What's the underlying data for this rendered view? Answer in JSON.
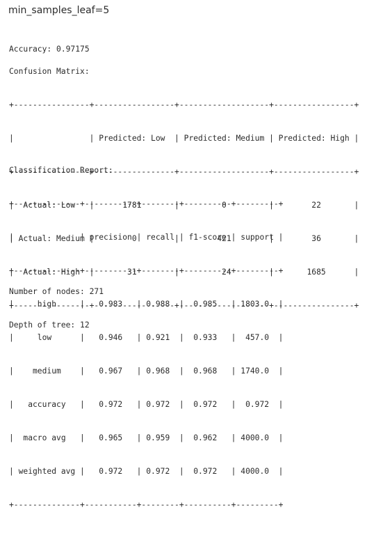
{
  "heading": "min_samples_leaf=5",
  "accuracy_text": "Accuracy: 0.97175",
  "confusion": {
    "title": "Confusion Matrix:",
    "rows": [
      "+----------------+-----------------+-------------------+-----------------+",
      "|                | Predicted: Low  | Predicted: Medium | Predicted: High |",
      "+----------------+-----------------+-------------------+-----------------+",
      "|  Actual: Low   |      1781       |         0         |        22       |",
      "| Actual: Medium |        0        |        421        |        36       |",
      "|  Actual: High  |       31        |         24        |       1685      |",
      "+----------------+-----------------+-------------------+-----------------+"
    ]
  },
  "report": {
    "title": "Classification Report:",
    "rows": [
      "+--------------+-----------+--------+----------+---------+",
      "|              | precision | recall | f1-score | support |",
      "+--------------+-----------+--------+----------+---------+",
      "|     high     |   0.983   | 0.988  |  0.985   | 1803.0  |",
      "|     low      |   0.946   | 0.921  |  0.933   |  457.0  |",
      "|    medium    |   0.967   | 0.968  |  0.968   | 1740.0  |",
      "|   accuracy   |   0.972   | 0.972  |  0.972   |  0.972  |",
      "|  macro avg   |   0.965   | 0.959  |  0.962   | 4000.0  |",
      "| weighted avg |   0.972   | 0.972  |  0.972   | 4000.0  |",
      "+--------------+-----------+--------+----------+---------+"
    ]
  },
  "footer": {
    "nodes": "Number of nodes: 271",
    "depth": "Depth of tree: 12"
  }
}
